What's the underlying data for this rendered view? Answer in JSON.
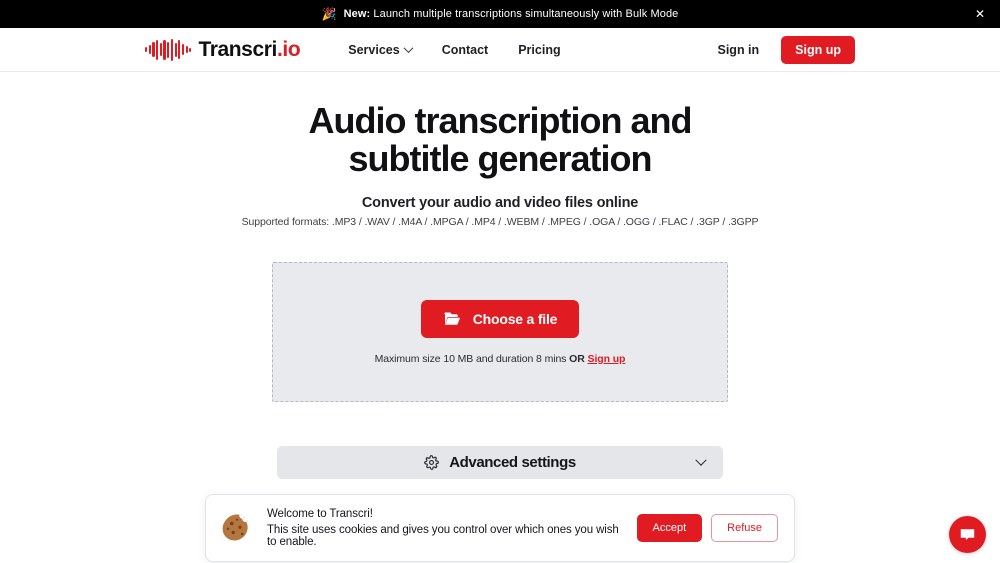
{
  "announcement": {
    "emoji": "🎉",
    "badge": "New:",
    "text": " Launch multiple transcriptions simultaneously with Bulk Mode",
    "close_label": "✕"
  },
  "header": {
    "brand": {
      "name": "Transcri",
      "suffix": ".io",
      "logo_icon": "audio-waveform-icon"
    },
    "nav": [
      {
        "label": "Services",
        "has_dropdown": true
      },
      {
        "label": "Contact",
        "has_dropdown": false
      },
      {
        "label": "Pricing",
        "has_dropdown": false
      }
    ],
    "sign_in_label": "Sign in",
    "sign_up_label": "Sign up"
  },
  "hero": {
    "title": "Audio transcription and subtitle generation",
    "subtitle": "Convert your audio and video files online",
    "formats": "Supported formats: .MP3 / .WAV / .M4A / .MPGA / .MP4 / .WEBM / .MPEG / .OGA / .OGG / .FLAC / .3GP / .3GPP"
  },
  "dropzone": {
    "button_label": "Choose a file",
    "button_icon": "folder-icon",
    "note_prefix": "Maximum size 10 MB and duration 8 mins ",
    "note_or": "OR",
    "note_link": "Sign up"
  },
  "advanced_settings": {
    "label": "Advanced settings",
    "icon": "gear-icon",
    "chevron": "chevron-down-icon"
  },
  "cookie_banner": {
    "icon": "cookie-icon",
    "title": "Welcome to Transcri!",
    "description": "This site uses cookies and gives you control over which ones you wish to enable.",
    "accept_label": "Accept",
    "refuse_label": "Refuse"
  },
  "chat_widget": {
    "icon": "chat-bubble-icon",
    "aria_label": "Open chat"
  },
  "colors": {
    "brand_red": "#e01b22",
    "banner_bg": "#000000",
    "dropzone_bg": "#e9eaee",
    "settings_bg": "#e4e6ea"
  }
}
